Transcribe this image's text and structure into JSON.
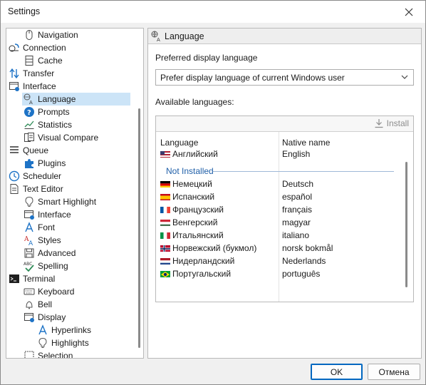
{
  "window": {
    "title": "Settings"
  },
  "tree": {
    "items": [
      {
        "label": "Navigation",
        "icon": "mouse-icon",
        "level": 1
      },
      {
        "label": "Connection",
        "icon": "connection-icon",
        "level": 0
      },
      {
        "label": "Cache",
        "icon": "cache-icon",
        "level": 1
      },
      {
        "label": "Transfer",
        "icon": "transfer-icon",
        "level": 0
      },
      {
        "label": "Interface",
        "icon": "interface-icon",
        "level": 0
      },
      {
        "label": "Language",
        "icon": "language-icon",
        "level": 1,
        "selected": true
      },
      {
        "label": "Prompts",
        "icon": "help-icon",
        "level": 1
      },
      {
        "label": "Statistics",
        "icon": "statistics-icon",
        "level": 1
      },
      {
        "label": "Visual Compare",
        "icon": "compare-icon",
        "level": 1
      },
      {
        "label": "Queue",
        "icon": "queue-icon",
        "level": 0
      },
      {
        "label": "Plugins",
        "icon": "puzzle-icon",
        "level": 1
      },
      {
        "label": "Scheduler",
        "icon": "clock-icon",
        "level": 0
      },
      {
        "label": "Text Editor",
        "icon": "document-icon",
        "level": 0
      },
      {
        "label": "Smart Highlight",
        "icon": "bulb-icon",
        "level": 1
      },
      {
        "label": "Interface",
        "icon": "interface-icon",
        "level": 1
      },
      {
        "label": "Font",
        "icon": "font-icon",
        "level": 1
      },
      {
        "label": "Styles",
        "icon": "styles-icon",
        "level": 1
      },
      {
        "label": "Advanced",
        "icon": "save-icon",
        "level": 1
      },
      {
        "label": "Spelling",
        "icon": "spelling-icon",
        "level": 1
      },
      {
        "label": "Terminal",
        "icon": "terminal-icon",
        "level": 0
      },
      {
        "label": "Keyboard",
        "icon": "keyboard-icon",
        "level": 1
      },
      {
        "label": "Bell",
        "icon": "bell-icon",
        "level": 1
      },
      {
        "label": "Display",
        "icon": "display-icon",
        "level": 1
      },
      {
        "label": "Hyperlinks",
        "icon": "font-icon",
        "level": 2
      },
      {
        "label": "Highlights",
        "icon": "bulb-icon",
        "level": 2
      },
      {
        "label": "Selection",
        "icon": "selection-icon",
        "level": 1
      }
    ]
  },
  "panel": {
    "header": "Language",
    "preferred_label": "Preferred display language",
    "dropdown_value": "Prefer display language of current Windows user",
    "available_label": "Available languages:",
    "install_label": "Install",
    "col_language": "Language",
    "col_native": "Native name",
    "installed": [
      {
        "name": "Английский",
        "native": "English",
        "flag": "us"
      }
    ],
    "group_not_installed": "Not Installed",
    "not_installed": [
      {
        "name": "Немецкий",
        "native": "Deutsch",
        "flag": "de"
      },
      {
        "name": "Испанский",
        "native": "español",
        "flag": "es"
      },
      {
        "name": "Французский",
        "native": "français",
        "flag": "fr"
      },
      {
        "name": "Венгерский",
        "native": "magyar",
        "flag": "hu"
      },
      {
        "name": "Итальянский",
        "native": "italiano",
        "flag": "it"
      },
      {
        "name": "Норвежский (букмол)",
        "native": "norsk bokmål",
        "flag": "no"
      },
      {
        "name": "Нидерландский",
        "native": "Nederlands",
        "flag": "nl"
      },
      {
        "name": "Португальский",
        "native": "português",
        "flag": "br"
      }
    ]
  },
  "buttons": {
    "ok": "OK",
    "cancel": "Отмена"
  },
  "colors": {
    "accent": "#0067c0",
    "selection": "#cce4f7",
    "group": "#1f5fa8"
  }
}
